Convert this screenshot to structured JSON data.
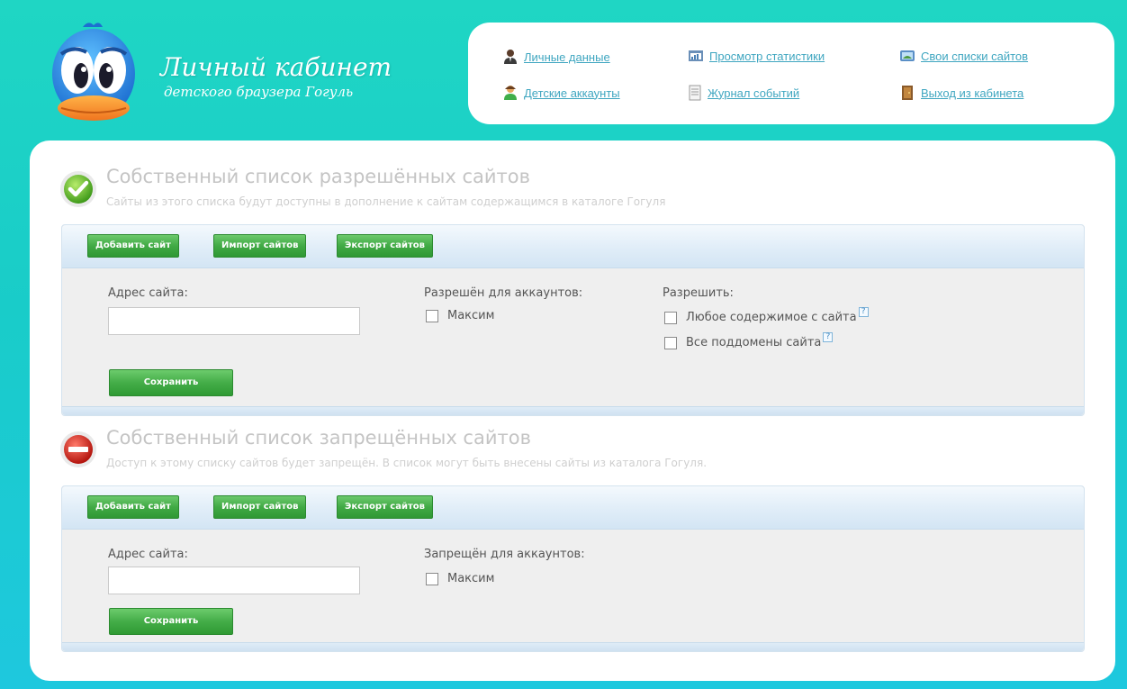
{
  "brand": {
    "title": "Личный кабинет",
    "subtitle": "детского браузера Гогуль"
  },
  "nav": {
    "items": [
      {
        "label": "Личные данные",
        "icon": "user-icon"
      },
      {
        "label": "Детские аккаунты",
        "icon": "child-accounts-icon"
      },
      {
        "label": "Просмотр статистики",
        "icon": "statistics-icon"
      },
      {
        "label": "Журнал событий",
        "icon": "event-log-icon"
      },
      {
        "label": "Свои списки сайтов",
        "icon": "site-lists-icon"
      },
      {
        "label": "Выход из кабинета",
        "icon": "exit-door-icon"
      }
    ]
  },
  "allowed": {
    "title": "Собственный список разрешённых сайтов",
    "description": "Сайты из этого списка будут доступны в дополнение к сайтам содержащимся в каталоге Гогуля",
    "icon": "check-icon",
    "toolbar": {
      "add": "Добавить сайт",
      "import": "Импорт сайтов",
      "export": "Экспорт сайтов"
    },
    "address_label": "Адрес сайта:",
    "address_value": "",
    "accounts_label": "Разрешён для аккаунтов:",
    "account_name": "Максим",
    "allow_label": "Разрешить:",
    "option_any_content": "Любое содержимое с сайта",
    "option_subdomains": "Все поддомены сайта",
    "help_mark": "?",
    "save": "Сохранить"
  },
  "blocked": {
    "title": "Собственный список запрещённых сайтов",
    "description": "Доступ к этому списку сайтов будет запрещён. В список могут быть внесены сайты из каталога Гогуля.",
    "icon": "stop-icon",
    "toolbar": {
      "add": "Добавить сайт",
      "import": "Импорт сайтов",
      "export": "Экспорт сайтов"
    },
    "address_label": "Адрес сайта:",
    "address_value": "",
    "accounts_label": "Запрещён для аккаунтов:",
    "account_name": "Максим",
    "save": "Сохранить"
  },
  "colors": {
    "background": "#1fd6c4",
    "link": "#3fa6c0",
    "button_green": "#41aa45",
    "muted_title": "#c4c4c4"
  }
}
